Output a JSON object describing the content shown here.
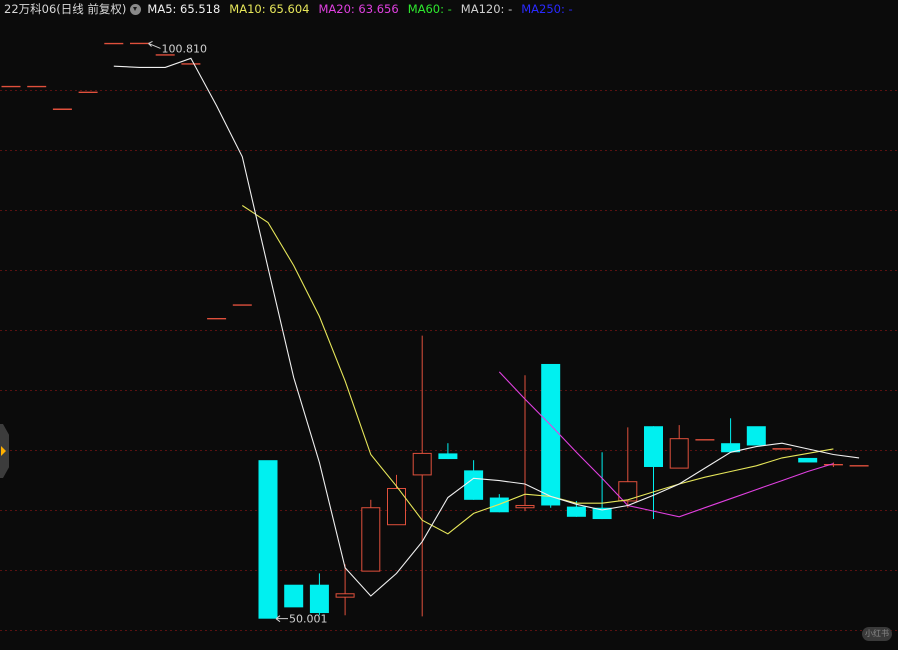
{
  "header": {
    "title": "22万科06(日线 前复权)",
    "ma5": "MA5: 65.518",
    "ma10": "MA10: 65.604",
    "ma20": "MA20: 63.656",
    "ma60": "MA60: -",
    "ma120": "MA120: -",
    "ma250": "MA250: -"
  },
  "watermark": "小红书",
  "colors": {
    "background": "#0b0b0b",
    "grid": "#5a1212",
    "up": "#e0503c",
    "down": "#00f0f0",
    "ma5": "#f0f0f0",
    "ma10": "#e6e65a",
    "ma20": "#e040e0",
    "ma60": "#2ee82e",
    "ma120": "#d0d0d0",
    "ma250": "#2a2aff"
  },
  "chart_data": {
    "type": "candlestick",
    "price_range": [
      49.0,
      102.0
    ],
    "max_label": "100.810",
    "min_label": "50.001",
    "candles": [
      {
        "o": 97.0,
        "h": 97.0,
        "l": 97.0,
        "c": 97.0
      },
      {
        "o": 97.0,
        "h": 97.0,
        "l": 97.0,
        "c": 97.0
      },
      {
        "o": 95.0,
        "h": 95.0,
        "l": 95.0,
        "c": 95.0
      },
      {
        "o": 96.5,
        "h": 96.5,
        "l": 96.5,
        "c": 96.5
      },
      {
        "o": 100.8,
        "h": 100.8,
        "l": 100.8,
        "c": 100.8
      },
      {
        "o": 100.81,
        "h": 100.81,
        "l": 100.81,
        "c": 100.81
      },
      {
        "o": 99.8,
        "h": 99.8,
        "l": 99.8,
        "c": 99.8
      },
      {
        "o": 99.0,
        "h": 99.0,
        "l": 99.0,
        "c": 99.0
      },
      {
        "o": 76.5,
        "h": 76.5,
        "l": 76.5,
        "c": 76.5
      },
      {
        "o": 77.7,
        "h": 77.7,
        "l": 77.7,
        "c": 77.7
      },
      {
        "o": 64.0,
        "h": 64.0,
        "l": 50.0,
        "c": 50.0
      },
      {
        "o": 53.0,
        "h": 53.0,
        "l": 51.0,
        "c": 51.0
      },
      {
        "o": 53.0,
        "h": 54.0,
        "l": 50.3,
        "c": 50.5
      },
      {
        "o": 51.9,
        "h": 54.8,
        "l": 50.3,
        "c": 52.2
      },
      {
        "o": 54.2,
        "h": 60.5,
        "l": 54.2,
        "c": 59.8
      },
      {
        "o": 58.3,
        "h": 62.7,
        "l": 58.3,
        "c": 61.5
      },
      {
        "o": 62.7,
        "h": 75.0,
        "l": 50.2,
        "c": 64.6
      },
      {
        "o": 64.6,
        "h": 65.5,
        "l": 64.1,
        "c": 64.1
      },
      {
        "o": 63.1,
        "h": 64.0,
        "l": 60.5,
        "c": 60.5
      },
      {
        "o": 60.7,
        "h": 61.0,
        "l": 59.4,
        "c": 59.4
      },
      {
        "o": 59.8,
        "h": 71.5,
        "l": 59.5,
        "c": 60.0
      },
      {
        "o": 72.5,
        "h": 72.5,
        "l": 59.8,
        "c": 60.0
      },
      {
        "o": 59.9,
        "h": 60.4,
        "l": 59.0,
        "c": 59.0
      },
      {
        "o": 59.8,
        "h": 64.7,
        "l": 58.8,
        "c": 58.8
      },
      {
        "o": 60.4,
        "h": 66.9,
        "l": 59.8,
        "c": 62.1
      },
      {
        "o": 67.0,
        "h": 67.0,
        "l": 58.8,
        "c": 63.4
      },
      {
        "o": 63.3,
        "h": 67.1,
        "l": 63.3,
        "c": 65.9
      },
      {
        "o": 65.8,
        "h": 65.8,
        "l": 65.8,
        "c": 65.8
      },
      {
        "o": 65.5,
        "h": 67.7,
        "l": 64.8,
        "c": 64.7
      },
      {
        "o": 67.0,
        "h": 67.0,
        "l": 65.3,
        "c": 65.3
      },
      {
        "o": 65.0,
        "h": 65.0,
        "l": 65.0,
        "c": 65.0
      },
      {
        "o": 64.2,
        "h": 64.2,
        "l": 63.8,
        "c": 63.8
      },
      {
        "o": 63.6,
        "h": 63.8,
        "l": 63.4,
        "c": 63.6
      },
      {
        "o": 63.5,
        "h": 63.5,
        "l": 63.5,
        "c": 63.5
      }
    ],
    "ma5": [
      null,
      null,
      null,
      null,
      98.8,
      98.7,
      98.7,
      99.5,
      95.3,
      90.8,
      81.0,
      71.3,
      63.8,
      54.5,
      52.0,
      54.0,
      56.8,
      60.7,
      62.4,
      62.2,
      61.9,
      60.8,
      60.1,
      59.6,
      60.0,
      60.9,
      61.9,
      63.3,
      64.7,
      65.2,
      65.5,
      65.0,
      64.5,
      64.2
    ],
    "ma10": [
      null,
      null,
      null,
      null,
      null,
      null,
      null,
      null,
      null,
      86.5,
      85.0,
      81.2,
      76.7,
      71.0,
      64.5,
      61.7,
      58.7,
      57.5,
      59.3,
      60.1,
      61.0,
      60.8,
      60.2,
      60.2,
      60.5,
      61.2,
      61.9,
      62.5,
      63.0,
      63.5,
      64.2,
      64.6,
      65.0
    ],
    "ma20": [
      null,
      null,
      null,
      null,
      null,
      null,
      null,
      null,
      null,
      null,
      null,
      null,
      null,
      null,
      null,
      null,
      null,
      null,
      null,
      71.8,
      69.4,
      67.1,
      64.7,
      62.4,
      60.0,
      59.5,
      59.0,
      59.8,
      60.6,
      61.4,
      62.2,
      63.0,
      63.7
    ],
    "grid_rows": 10
  }
}
